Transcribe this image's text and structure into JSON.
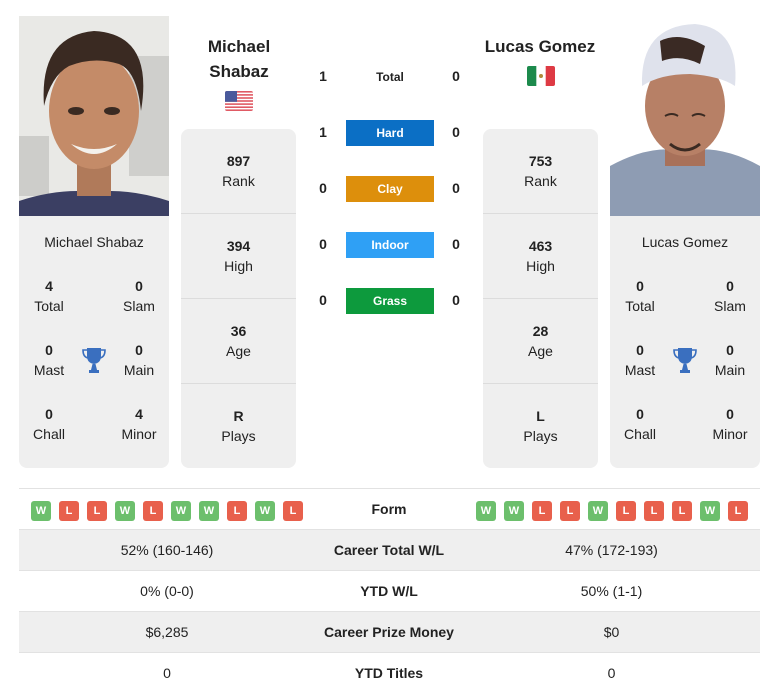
{
  "colors": {
    "hard": "#0b6fc5",
    "clay": "#dd8f0c",
    "indoor": "#2fa0f5",
    "grass": "#0d9a3d",
    "win": "#6cbf6c",
    "loss": "#e8604c",
    "trophy": "#3a6fbf"
  },
  "player1": {
    "name_line1": "Michael",
    "name_line2": "Shabaz",
    "full_name": "Michael Shabaz",
    "flag": "usa-flag",
    "titles": {
      "total": {
        "value": "4",
        "label": "Total"
      },
      "slam": {
        "value": "0",
        "label": "Slam"
      },
      "mast": {
        "value": "0",
        "label": "Mast"
      },
      "main": {
        "value": "0",
        "label": "Main"
      },
      "chall": {
        "value": "0",
        "label": "Chall"
      },
      "minor": {
        "value": "4",
        "label": "Minor"
      }
    },
    "info": {
      "rank": {
        "value": "897",
        "label": "Rank"
      },
      "high": {
        "value": "394",
        "label": "High"
      },
      "age": {
        "value": "36",
        "label": "Age"
      },
      "plays": {
        "value": "R",
        "label": "Plays"
      }
    },
    "form": [
      "W",
      "L",
      "L",
      "W",
      "L",
      "W",
      "W",
      "L",
      "W",
      "L"
    ],
    "career_wl": "52% (160-146)",
    "ytd_wl": "0% (0-0)",
    "prize_money": "$6,285",
    "ytd_titles": "0"
  },
  "player2": {
    "name": "Lucas Gomez",
    "full_name": "Lucas Gomez",
    "flag": "mexico-flag",
    "titles": {
      "total": {
        "value": "0",
        "label": "Total"
      },
      "slam": {
        "value": "0",
        "label": "Slam"
      },
      "mast": {
        "value": "0",
        "label": "Mast"
      },
      "main": {
        "value": "0",
        "label": "Main"
      },
      "chall": {
        "value": "0",
        "label": "Chall"
      },
      "minor": {
        "value": "0",
        "label": "Minor"
      }
    },
    "info": {
      "rank": {
        "value": "753",
        "label": "Rank"
      },
      "high": {
        "value": "463",
        "label": "High"
      },
      "age": {
        "value": "28",
        "label": "Age"
      },
      "plays": {
        "value": "L",
        "label": "Plays"
      }
    },
    "form": [
      "W",
      "W",
      "L",
      "L",
      "W",
      "L",
      "L",
      "L",
      "W",
      "L"
    ],
    "career_wl": "47% (172-193)",
    "ytd_wl": "50% (1-1)",
    "prize_money": "$0",
    "ytd_titles": "0"
  },
  "h2h": [
    {
      "label": "Total",
      "p1": "1",
      "p2": "0",
      "type": "total"
    },
    {
      "label": "Hard",
      "p1": "1",
      "p2": "0",
      "type": "hard"
    },
    {
      "label": "Clay",
      "p1": "0",
      "p2": "0",
      "type": "clay"
    },
    {
      "label": "Indoor",
      "p1": "0",
      "p2": "0",
      "type": "indoor"
    },
    {
      "label": "Grass",
      "p1": "0",
      "p2": "0",
      "type": "grass"
    }
  ],
  "stats_labels": {
    "form": "Form",
    "career_wl": "Career Total W/L",
    "ytd_wl": "YTD W/L",
    "prize_money": "Career Prize Money",
    "ytd_titles": "YTD Titles"
  }
}
